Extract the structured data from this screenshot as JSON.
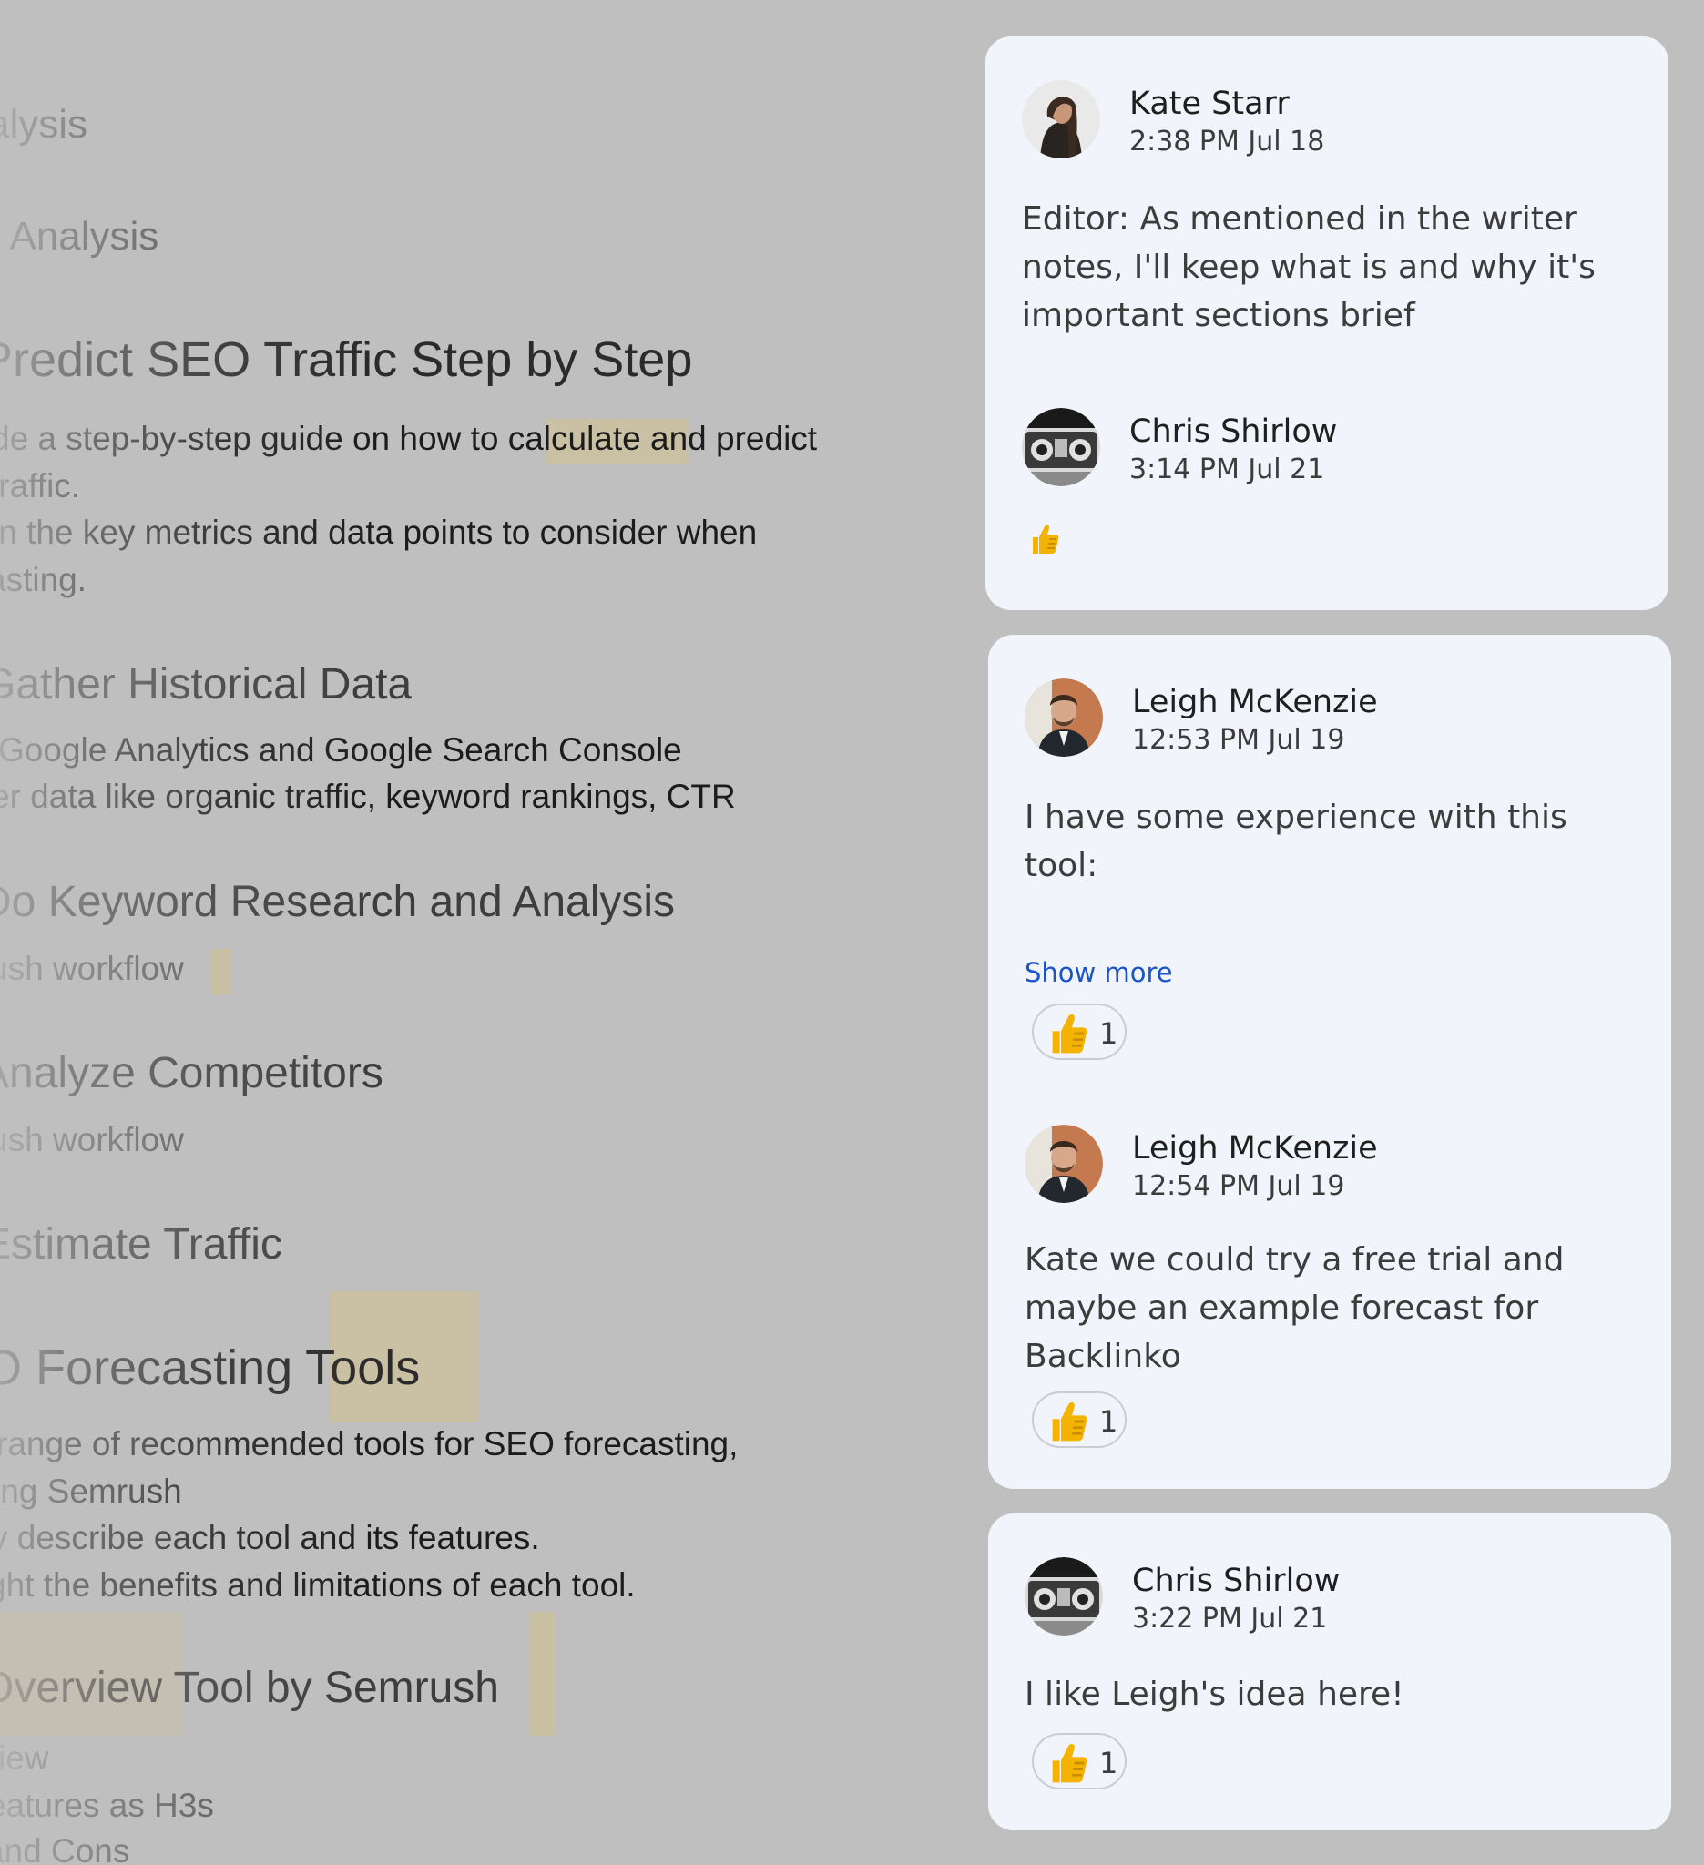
{
  "document": {
    "lines": [
      "alysis",
      "r Analysis",
      "Predict SEO Traffic Step by Step",
      "de a step-by-step guide on how to calculate and predict",
      "traffic.",
      "in the key metrics and data points to consider when",
      "asting.",
      "Gather Historical Data",
      "Google Analytics and Google Search Console",
      "er data like organic traffic, keyword rankings, CTR",
      "Do Keyword Research and Analysis",
      "ush workflow",
      "Analyze Competitors",
      "ush workflow",
      "Estimate Traffic",
      "O Forecasting Tools",
      "range of recommended tools for SEO forecasting,",
      "ing Semrush",
      "y describe each tool and its features.",
      "ght the benefits and limitations of each tool.",
      "Overview Tool by Semrush",
      "iew",
      "eatures as H3s",
      "and Cons"
    ]
  },
  "threads": [
    {
      "comments": [
        {
          "author": "Kate Starr",
          "time": "2:38 PM Jul 18",
          "avatar": "woman-avatar",
          "text": [
            "Editor: As mentioned in the writer",
            "notes, I'll keep what is and why it's",
            "important sections brief"
          ]
        },
        {
          "author": "Chris Shirlow",
          "time": "3:14 PM Jul 21",
          "avatar": "boombox-avatar",
          "reaction_emoji": "👍"
        }
      ]
    },
    {
      "comments": [
        {
          "author": "Leigh McKenzie",
          "time": "12:53 PM Jul 19",
          "avatar": "man-avatar",
          "text": [
            "I have some experience with this",
            "tool:"
          ],
          "show_more": "Show more",
          "reaction": {
            "emoji": "👍",
            "count": "1"
          }
        },
        {
          "author": "Leigh McKenzie",
          "time": "12:54 PM Jul 19",
          "avatar": "man-avatar",
          "text": [
            "Kate we could try a free trial and",
            "maybe an example forecast for",
            "Backlinko"
          ],
          "reaction": {
            "emoji": "👍",
            "count": "1"
          }
        }
      ]
    },
    {
      "comments": [
        {
          "author": "Chris Shirlow",
          "time": "3:22 PM Jul 21",
          "avatar": "boombox-avatar",
          "text": [
            "I like Leigh's idea here!"
          ],
          "reaction": {
            "emoji": "👍",
            "count": "1"
          }
        }
      ]
    }
  ],
  "colors": {
    "background": "#bfbfbf",
    "card": "#f1f4fa",
    "link": "#1a56c8",
    "highlight": "#cbbf9d",
    "thumb": "#f5b301"
  }
}
